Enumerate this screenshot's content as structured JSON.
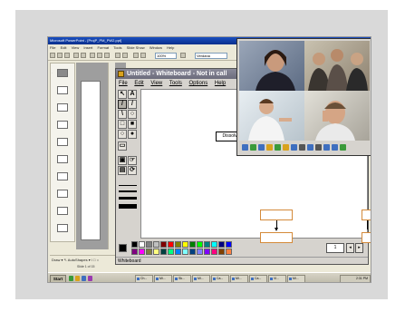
{
  "powerpoint": {
    "title": "Microsoft PowerPoint - [ProjP_PM_PW2.ppt]",
    "menu": [
      "File",
      "Edit",
      "View",
      "Insert",
      "Format",
      "Tools",
      "Slide Show",
      "Window",
      "Help"
    ],
    "zoom": "100%",
    "font": "Verdana",
    "draw_toolbar": "Draw ▾  ↖  AutoShapes ▾  \\  □  ○",
    "status": "Slide 1 of 15"
  },
  "whiteboard": {
    "title": "Untitled - Whiteboard - Not in call",
    "menu": [
      "File",
      "Edit",
      "View",
      "Tools",
      "Options",
      "Help"
    ],
    "box_label": "Dissolve",
    "status": "Whiteboard",
    "page": "1",
    "total_pages_btn": "1",
    "palette": [
      "#000000",
      "#ffffff",
      "#808080",
      "#c0c0c0",
      "#800000",
      "#ff0000",
      "#808000",
      "#ffff00",
      "#008000",
      "#00ff00",
      "#008080",
      "#00ffff",
      "#000080",
      "#0000ff",
      "#800080",
      "#ff00ff",
      "#808040",
      "#ffff80",
      "#004040",
      "#00ff80",
      "#0080ff",
      "#80ffff",
      "#004080",
      "#8080ff",
      "#8000ff",
      "#ff0080",
      "#804000",
      "#ff8040"
    ]
  },
  "taskbar": {
    "start": "Start",
    "tasks": [
      "Ch...",
      "Mi...",
      "Sk...",
      "Mi...",
      "Ca...",
      "Mi...",
      "Ca...",
      "Vi...",
      "Mi..."
    ],
    "clock": "2:31 PM"
  },
  "colors": {
    "accent_orange": "#d48a3a",
    "titlebar_blue": "#0a2f8c"
  }
}
